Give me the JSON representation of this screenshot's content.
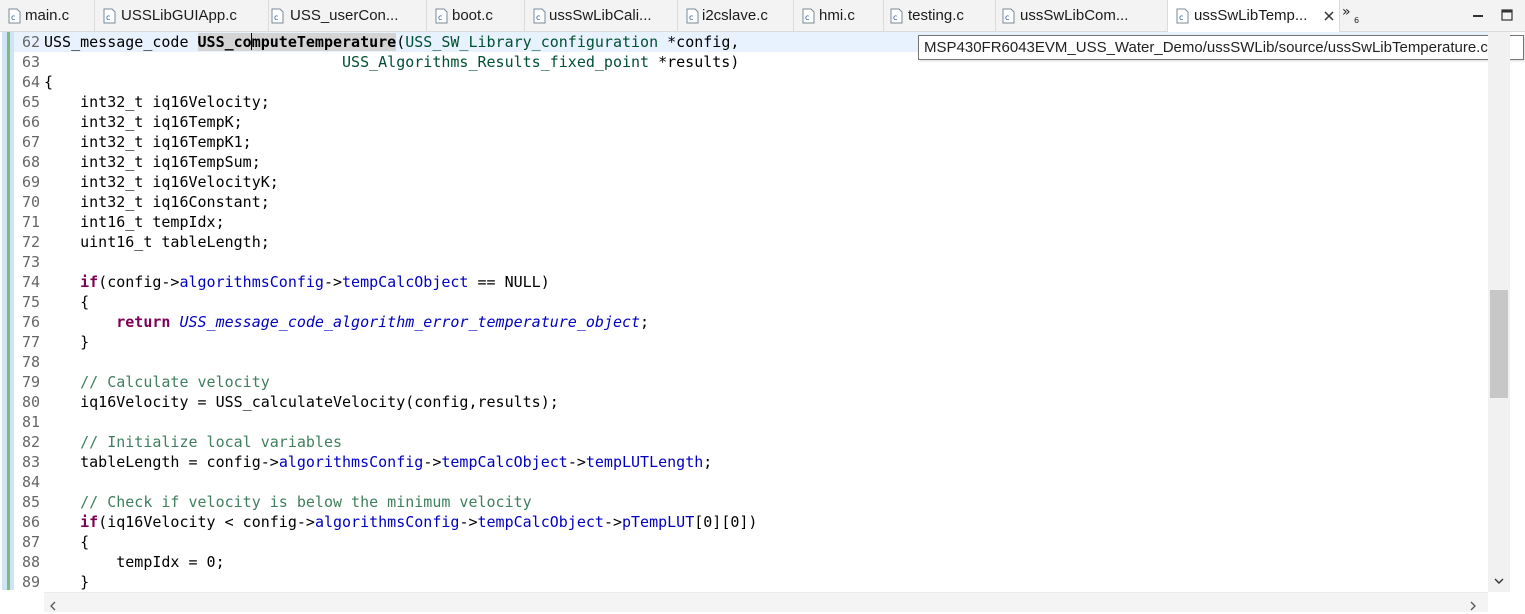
{
  "tabs": [
    {
      "label": "main.c",
      "active": false
    },
    {
      "label": "USSLibGUIApp.c",
      "active": false
    },
    {
      "label": "USS_userCon...",
      "active": false
    },
    {
      "label": "boot.c",
      "active": false
    },
    {
      "label": "ussSwLibCali...",
      "active": false
    },
    {
      "label": "i2cslave.c",
      "active": false
    },
    {
      "label": "hmi.c",
      "active": false
    },
    {
      "label": "testing.c",
      "active": false
    },
    {
      "label": "ussSwLibCom...",
      "active": false
    },
    {
      "label": "ussSwLibTemp...",
      "active": true
    }
  ],
  "overflow": {
    "symbol": "»",
    "count": "6"
  },
  "tooltip": {
    "text": "MSP430FR6043EVM_USS_Water_Demo/ussSWLib/source/ussSwLibTemperature.c"
  },
  "editor": {
    "line_numbers": [
      "62",
      "63",
      "64",
      "65",
      "66",
      "67",
      "68",
      "69",
      "70",
      "71",
      "72",
      "73",
      "74",
      "75",
      "76",
      "77",
      "78",
      "79",
      "80",
      "81",
      "82",
      "83",
      "84",
      "85",
      "86",
      "87",
      "88",
      "89"
    ],
    "lines": [
      [
        [
          "",
          "USS_message_code "
        ],
        [
          "fn",
          "USS_co"
        ],
        [
          "cursor",
          ""
        ],
        [
          "fn",
          "mputeTemperature"
        ],
        [
          "",
          "("
        ],
        [
          "typ",
          "USS_SW_Library_configuration"
        ],
        [
          "",
          " *config,"
        ]
      ],
      [
        [
          "",
          "                                 "
        ],
        [
          "typ",
          "USS_Algorithms_Results_fixed_point"
        ],
        [
          "",
          " *results)"
        ]
      ],
      [
        [
          "",
          "{"
        ]
      ],
      [
        [
          "",
          "    int32_t iq16Velocity;"
        ]
      ],
      [
        [
          "",
          "    int32_t iq16TempK;"
        ]
      ],
      [
        [
          "",
          "    int32_t iq16TempK1;"
        ]
      ],
      [
        [
          "",
          "    int32_t iq16TempSum;"
        ]
      ],
      [
        [
          "",
          "    int32_t iq16VelocityK;"
        ]
      ],
      [
        [
          "",
          "    int32_t iq16Constant;"
        ]
      ],
      [
        [
          "",
          "    int16_t tempIdx;"
        ]
      ],
      [
        [
          "",
          "    uint16_t tableLength;"
        ]
      ],
      [
        [
          "",
          ""
        ]
      ],
      [
        [
          "",
          "    "
        ],
        [
          "kw",
          "if"
        ],
        [
          "",
          "(config->"
        ],
        [
          "fld",
          "algorithmsConfig"
        ],
        [
          "",
          "->"
        ],
        [
          "fld",
          "tempCalcObject"
        ],
        [
          "",
          " == NULL)"
        ]
      ],
      [
        [
          "",
          "    {"
        ]
      ],
      [
        [
          "",
          "        "
        ],
        [
          "kw",
          "return"
        ],
        [
          "",
          " "
        ],
        [
          "enm",
          "USS_message_code_algorithm_error_temperature_object"
        ],
        [
          "",
          ";"
        ]
      ],
      [
        [
          "",
          "    }"
        ]
      ],
      [
        [
          "",
          ""
        ]
      ],
      [
        [
          "",
          "    "
        ],
        [
          "cm",
          "// Calculate velocity"
        ]
      ],
      [
        [
          "",
          "    iq16Velocity = USS_calculateVelocity(config,results);"
        ]
      ],
      [
        [
          "",
          ""
        ]
      ],
      [
        [
          "",
          "    "
        ],
        [
          "cm",
          "// Initialize local variables"
        ]
      ],
      [
        [
          "",
          "    tableLength = config->"
        ],
        [
          "fld",
          "algorithmsConfig"
        ],
        [
          "",
          "->"
        ],
        [
          "fld",
          "tempCalcObject"
        ],
        [
          "",
          "->"
        ],
        [
          "fld",
          "tempLUTLength"
        ],
        [
          "",
          ";"
        ]
      ],
      [
        [
          "",
          ""
        ]
      ],
      [
        [
          "",
          "    "
        ],
        [
          "cm",
          "// Check if velocity is below the minimum velocity"
        ]
      ],
      [
        [
          "",
          "    "
        ],
        [
          "kw",
          "if"
        ],
        [
          "",
          "(iq16Velocity < config->"
        ],
        [
          "fld",
          "algorithmsConfig"
        ],
        [
          "",
          "->"
        ],
        [
          "fld",
          "tempCalcObject"
        ],
        [
          "",
          "->"
        ],
        [
          "fld",
          "pTempLUT"
        ],
        [
          "",
          "[0][0])"
        ]
      ],
      [
        [
          "",
          "    {"
        ]
      ],
      [
        [
          "",
          "        tempIdx = 0;"
        ]
      ],
      [
        [
          "",
          "    }"
        ]
      ]
    ]
  },
  "colors": {
    "keyword": "#7f0055",
    "comment": "#3f7f5f",
    "field": "#0000c0",
    "type": "#005032",
    "current_line": "#e8f2fe"
  },
  "icons": {
    "tab_file": "c-source-file-icon",
    "active_tab_close": "close-icon",
    "minimize": "minimize-icon",
    "maximize": "maximize-icon"
  }
}
